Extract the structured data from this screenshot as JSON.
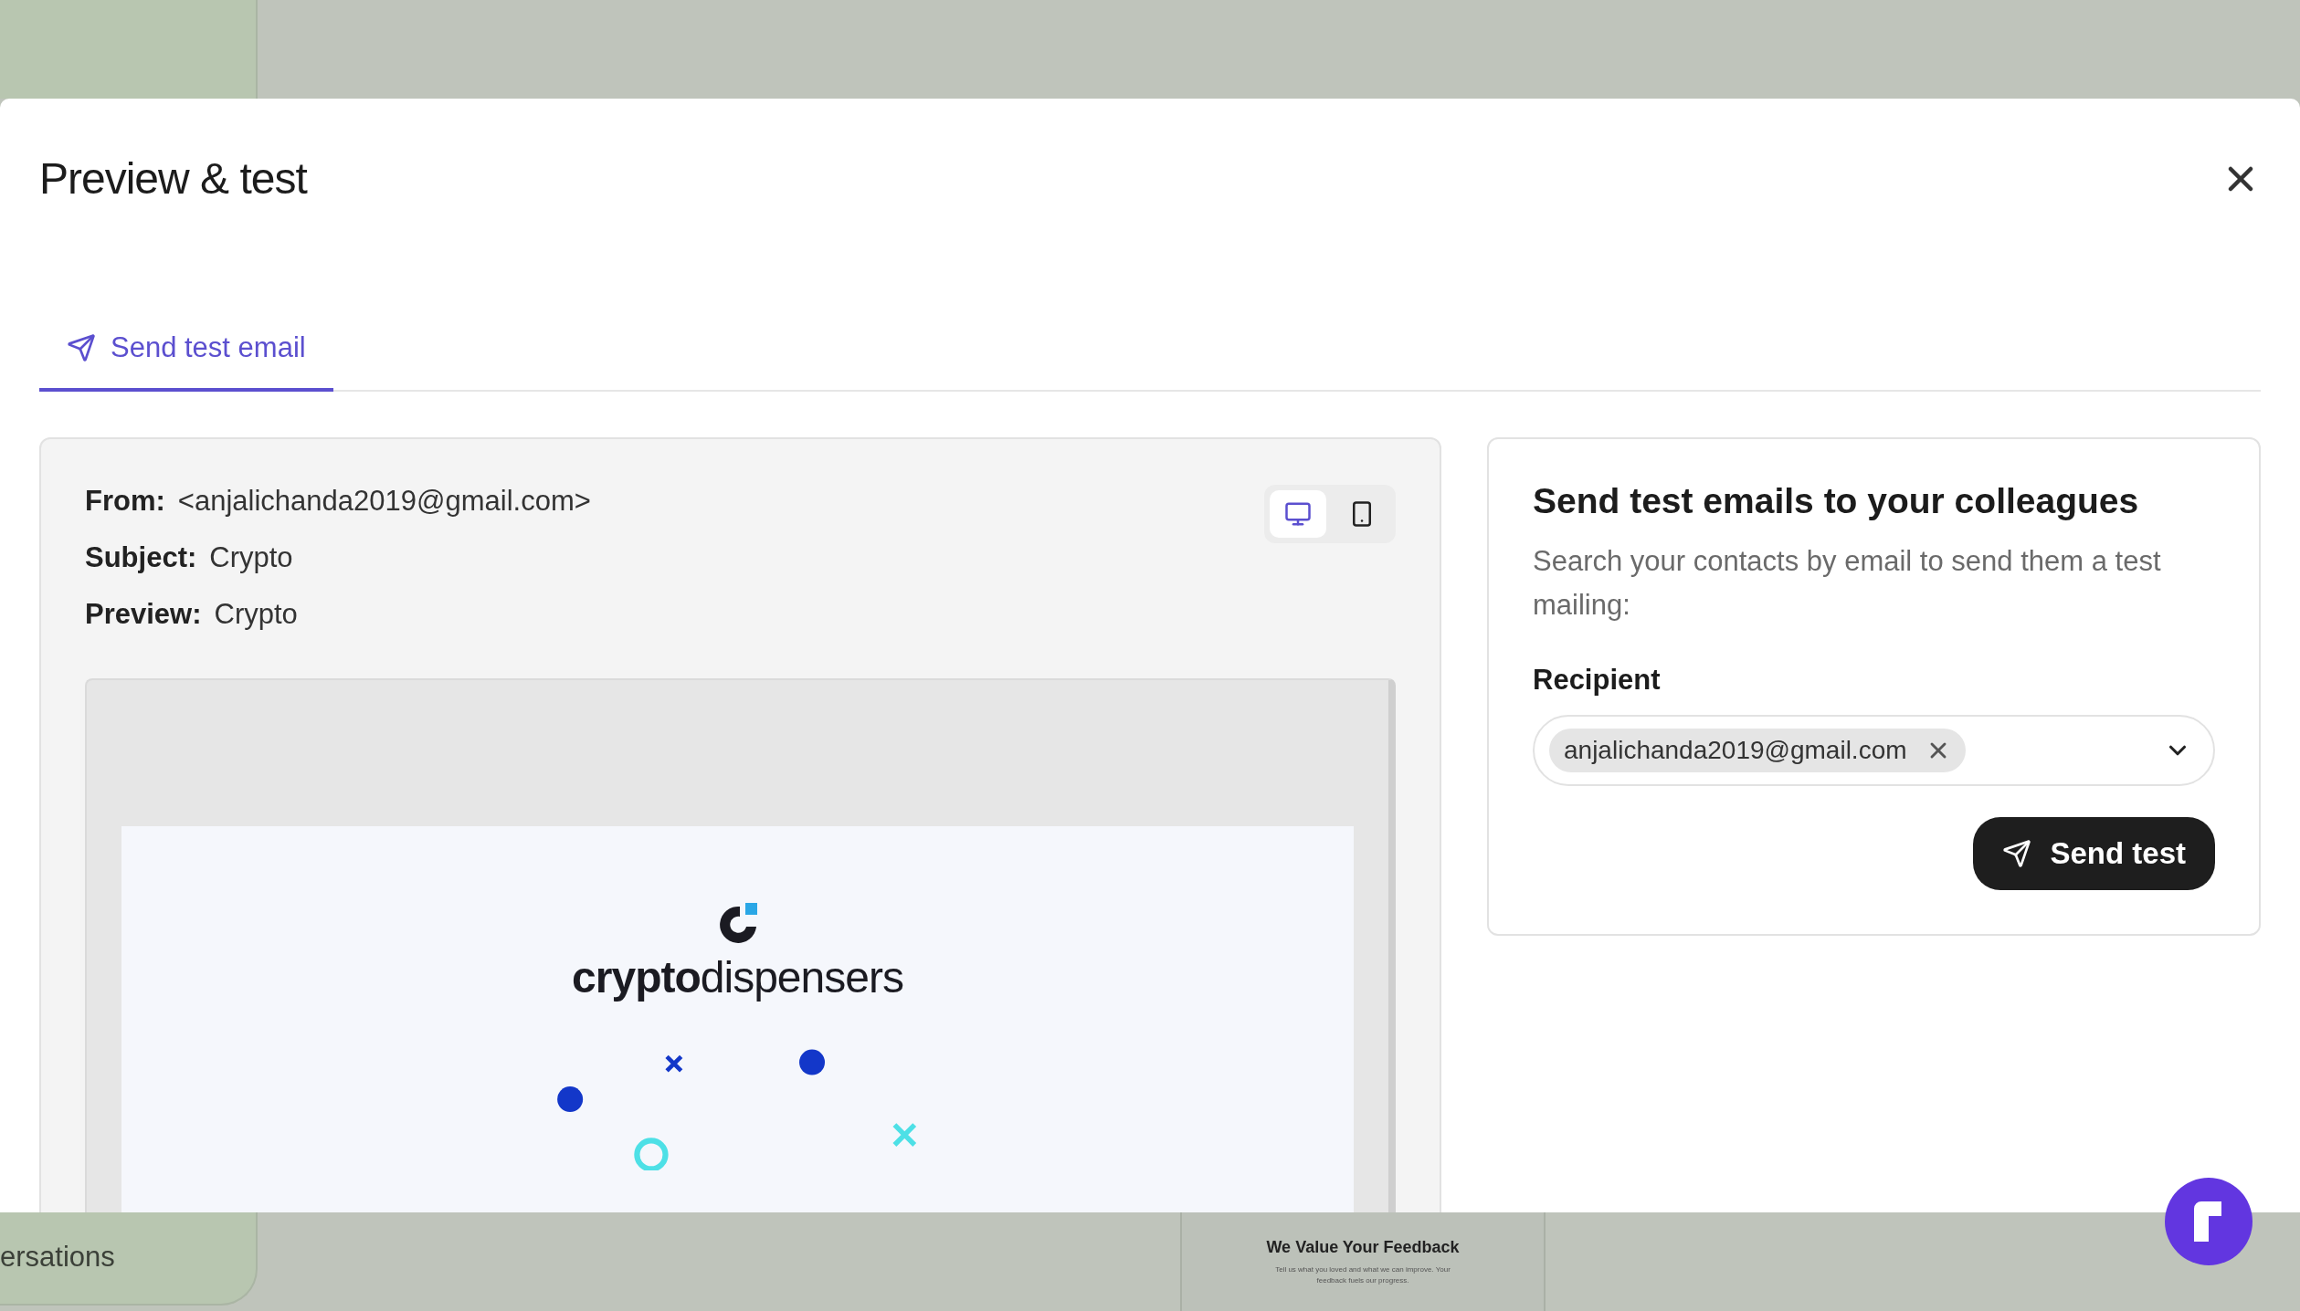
{
  "background": {
    "sidebar_item": "ersations",
    "feedback_card": {
      "title": "We Value Your Feedback",
      "body": "Tell us what you loved and what we can improve. Your feedback fuels our progress."
    }
  },
  "modal": {
    "title": "Preview & test",
    "tabs": [
      {
        "label": "Send test email",
        "selected": true
      }
    ],
    "preview": {
      "fields": [
        {
          "label": "From:",
          "value": "<anjalichanda2019@gmail.com>"
        },
        {
          "label": "Subject:",
          "value": "Crypto"
        },
        {
          "label": "Preview:",
          "value": "Crypto"
        }
      ],
      "devices": [
        {
          "kind": "desktop",
          "selected": true
        },
        {
          "kind": "mobile",
          "selected": false
        }
      ],
      "email": {
        "logo": "**crypto**dispensers"
      }
    },
    "send_panel": {
      "title": "Send test emails to your colleagues",
      "description": "Search your contacts by email to send them a test mailing:",
      "recipient_label": "Recipient",
      "recipients": [
        "anjalichanda2019@gmail.com"
      ],
      "button": "Send test"
    }
  }
}
